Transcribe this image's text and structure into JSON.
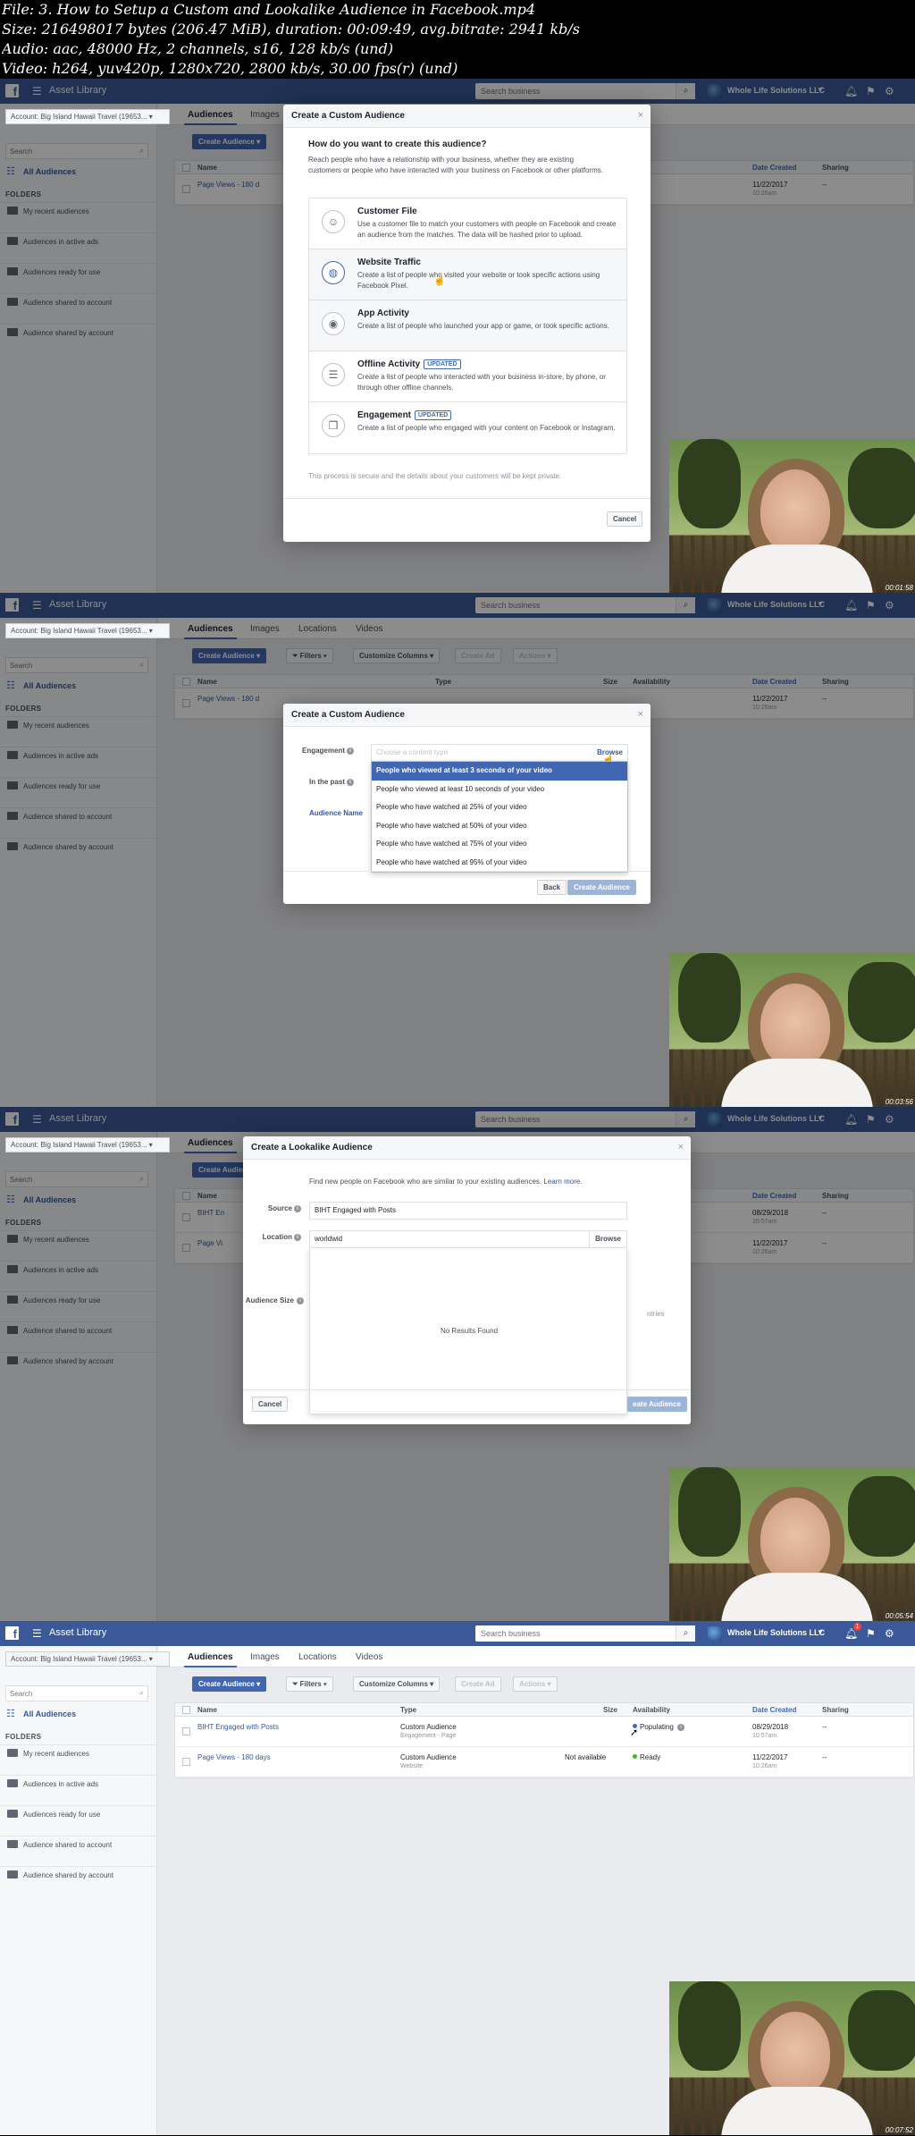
{
  "file_info": [
    "File: 3. How to Setup a Custom and Lookalike Audience in Facebook.mp4",
    "Size: 216498017 bytes (206.47 MiB), duration: 00:09:49, avg.bitrate: 2941 kb/s",
    "Audio: aac, 48000 Hz, 2 channels, s16, 128 kb/s (und)",
    "Video: h264, yuv420p, 1280x720, 2800 kb/s, 30.00 fps(r) (und)"
  ],
  "colors": {
    "facebook_blue": "#3b5998",
    "primary_button": "#4267b2",
    "ready_dot": "#42b72a"
  },
  "topbar": {
    "logo": "f",
    "menu_icon": "hamburger-icon",
    "title": "Asset Library",
    "search_placeholder": "Search business",
    "business_name": "Whole Life Solutions LLC",
    "notification_count": "1"
  },
  "sidebar": {
    "account": "Account: Big Island Hawaii Travel (19653...",
    "search_placeholder": "Search",
    "all_audiences": "All Audiences",
    "folders_title": "FOLDERS",
    "folders": [
      "My recent audiences",
      "Audiences in active ads",
      "Audiences ready for use",
      "Audience shared to account",
      "Audience shared by account"
    ]
  },
  "tabs": [
    "Audiences",
    "Images",
    "Locations",
    "Videos"
  ],
  "toolbar": {
    "create_audience": "Create Audience",
    "filters": "Filters",
    "customize_columns": "Customize Columns",
    "create_ad": "Create Ad",
    "actions": "Actions"
  },
  "table": {
    "headers": [
      "Name",
      "Type",
      "Size",
      "Availability",
      "Date Created",
      "Sharing"
    ],
    "rows": [
      {
        "name": "BIHT Engaged with Posts",
        "type": "Custom Audience",
        "type_sub": "Engagement - Page",
        "size": "",
        "availability": "Populating",
        "date": "08/29/2018",
        "time": "10:57am",
        "sharing": "--"
      },
      {
        "name": "Page Views - 180 days",
        "type": "Custom Audience",
        "type_sub": "Website",
        "size": "Not available",
        "availability": "Ready",
        "date": "11/22/2017",
        "time": "10:26am",
        "sharing": "--"
      }
    ],
    "truncated_names": [
      "Page Views - 180 d",
      "BIHT En",
      "Page Vi"
    ]
  },
  "modal_custom": {
    "title": "Create a Custom Audience",
    "question": "How do you want to create this audience?",
    "intro": "Reach people who have a relationship with your business, whether they are existing customers or people who have interacted with your business on Facebook or other platforms.",
    "options": [
      {
        "icon": "customer-file-icon",
        "title": "Customer File",
        "tag": "",
        "desc": "Use a customer file to match your customers with people on Facebook and create an audience from the matches. The data will be hashed prior to upload."
      },
      {
        "icon": "globe-icon",
        "title": "Website Traffic",
        "tag": "",
        "desc": "Create a list of people who visited your website or took specific actions using Facebook Pixel."
      },
      {
        "icon": "app-icon",
        "title": "App Activity",
        "tag": "",
        "desc": "Create a list of people who launched your app or game, or took specific actions."
      },
      {
        "icon": "store-icon",
        "title": "Offline Activity",
        "tag": "UPDATED",
        "desc": "Create a list of people who interacted with your business in-store, by phone, or through other offline channels."
      },
      {
        "icon": "engagement-icon",
        "title": "Engagement",
        "tag": "UPDATED",
        "desc": "Create a list of people who engaged with your content on Facebook or Instagram."
      }
    ],
    "footer_note": "This process is secure and the details about your customers will be kept private.",
    "cancel": "Cancel"
  },
  "modal_engagement": {
    "title": "Create a Custom Audience",
    "engagement_label": "Engagement",
    "in_the_past_label": "In the past",
    "audience_name_label": "Audience Name",
    "content_placeholder": "Choose a content type",
    "browse": "Browse",
    "dropdown": [
      "People who viewed at least 3 seconds of your video",
      "People who viewed at least 10 seconds of your video",
      "People who have watched at 25% of your video",
      "People who have watched at 50% of your video",
      "People who have watched at 75% of your video",
      "People who have watched at 95% of your video"
    ],
    "back": "Back",
    "create": "Create Audience"
  },
  "modal_lookalike": {
    "title": "Create a Lookalike Audience",
    "intro": "Find new people on Facebook who are similar to your existing audiences.",
    "learn_more": "Learn more.",
    "source_label": "Source",
    "source_value": "BIHT Engaged with Posts",
    "location_label": "Location",
    "location_value": "worldwid",
    "browse": "Browse",
    "audience_size_label": "Audience Size",
    "no_results": "No Results Found",
    "countries_fragment": "ntries",
    "cancel": "Cancel",
    "create_fragment": "eate Audience"
  },
  "webcam": {
    "timestamps": [
      "00:01:58",
      "00:03:56",
      "00:05:54",
      "00:07:52"
    ]
  }
}
